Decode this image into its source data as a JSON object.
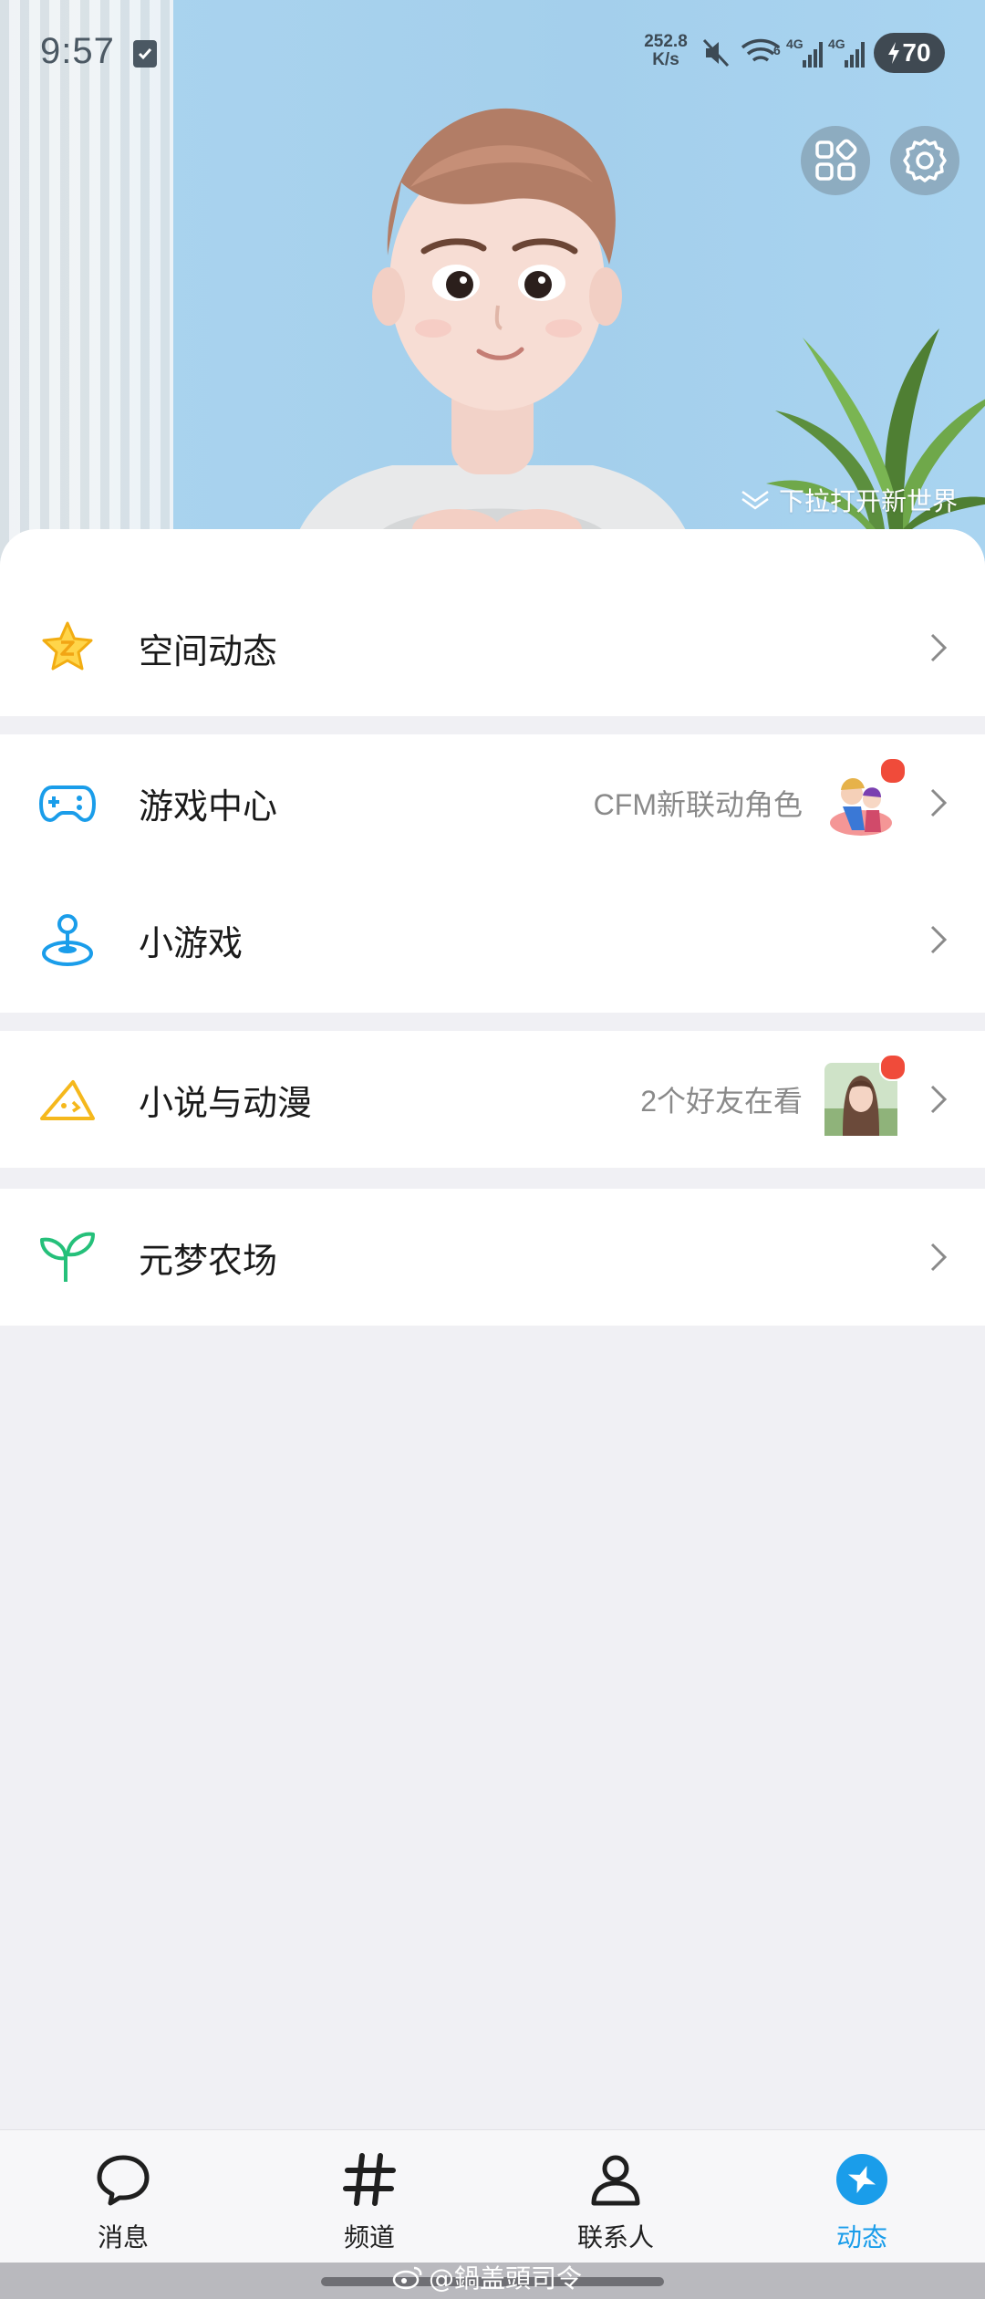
{
  "status_bar": {
    "time": "9:57",
    "net_speed_value": "252.8",
    "net_speed_unit": "K/s",
    "battery": "70",
    "network_labels": [
      "6",
      "4G",
      "4G"
    ]
  },
  "hero": {
    "pull_hint": "下拉打开新世界"
  },
  "menu": {
    "items": [
      {
        "title": "空间动态",
        "subtitle": "",
        "icon": "star-z-icon",
        "color": "#f5b81c"
      },
      {
        "title": "游戏中心",
        "subtitle": "CFM新联动角色",
        "icon": "gamepad-icon",
        "color": "#1a9dea"
      },
      {
        "title": "小游戏",
        "subtitle": "",
        "icon": "joystick-icon",
        "color": "#1a9dea"
      },
      {
        "title": "小说与动漫",
        "subtitle": "2个好友在看",
        "icon": "book-icon",
        "color": "#f5b81c"
      },
      {
        "title": "元梦农场",
        "subtitle": "",
        "icon": "sprout-icon",
        "color": "#25c07a"
      }
    ]
  },
  "tabbar": {
    "tabs": [
      {
        "label": "消息",
        "icon": "chat-bubble-icon"
      },
      {
        "label": "频道",
        "icon": "hash-icon"
      },
      {
        "label": "联系人",
        "icon": "person-icon"
      },
      {
        "label": "动态",
        "icon": "star-compass-icon",
        "active": true
      }
    ],
    "active_color": "#1a9dea"
  },
  "watermark": "@鍋盖頭司令"
}
